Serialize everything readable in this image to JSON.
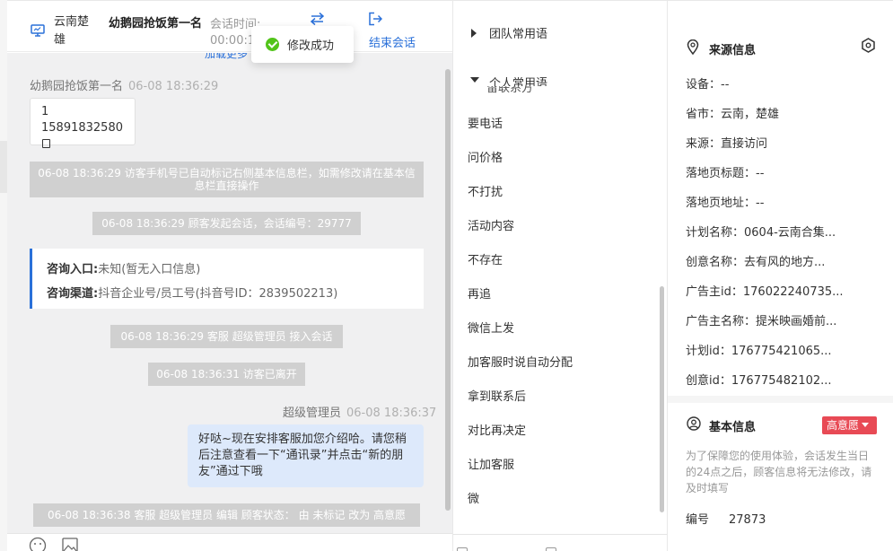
{
  "header": {
    "location": "云南楚雄",
    "visitor_name": "幼鹅园抢饭第一名",
    "session_time_label": "会话时间:",
    "session_time_value": "00:00:1",
    "end_session_label": "结束会话"
  },
  "toast": {
    "text": "修改成功"
  },
  "chat": {
    "load_more": "加载更多",
    "visitor_meta": {
      "name": "幼鹅园抢饭第一名",
      "time": "06-08 18:36:29"
    },
    "card": {
      "line1": "1",
      "line2": "15891832580"
    },
    "system_messages": [
      "06-08 18:36:29 访客手机号已自动标记右侧基本信息栏，如需修改请在基本信息栏直接操作",
      "06-08 18:36:29 顾客发起会话，会话编号：29777",
      "06-08 18:36:29 客服 超级管理员 接入会话",
      "06-08 18:36:31 访客已离开",
      "06-08 18:36:38 客服 超级管理员 编辑 顾客状态： 由 未标记 改为 高意愿"
    ],
    "info": {
      "entry_label": "咨询入口:",
      "entry_value": "未知(暂无入口信息)",
      "channel_label": "咨询渠道:",
      "channel_value": "抖音企业号/员工号(抖音号ID：2839502213)"
    },
    "agent_meta": {
      "name": "超级管理员",
      "time": "06-08 18:36:37"
    },
    "agent_message": "好哒~现在安排客服加您介绍哈。请您稍后注意查看一下“通讯录”并点击“新的朋友”通过下哦"
  },
  "phrases": {
    "team_group": "团队常用语",
    "personal_group": "个人常用语",
    "hidden_item": "留联系方",
    "items": [
      "要电话",
      "问价格",
      "不打扰",
      "活动内容",
      "不存在",
      "再追",
      "微信上发",
      "加客服时说自动分配",
      "拿到联系后",
      "对比再决定",
      "让加客服",
      "微"
    ]
  },
  "source_info": {
    "title": "来源信息",
    "rows": [
      {
        "label": "设备：",
        "value": "--"
      },
      {
        "label": "省市：",
        "value": "云南，楚雄"
      },
      {
        "label": "来源：",
        "value": "直接访问"
      },
      {
        "label": "落地页标题：",
        "value": "--"
      },
      {
        "label": "落地页地址：",
        "value": "--"
      },
      {
        "label": "计划名称：",
        "value": "0604-云南合集..."
      },
      {
        "label": "创意名称：",
        "value": "去有风的地方..."
      },
      {
        "label": "广告主id：",
        "value": "176022240735..."
      },
      {
        "label": "广告主名称：",
        "value": "提米映画婚前..."
      },
      {
        "label": "计划id：",
        "value": "176775421065..."
      },
      {
        "label": "创意id：",
        "value": "176775482102..."
      }
    ]
  },
  "basic_info": {
    "title": "基本信息",
    "status_tag": "高意愿",
    "notice": "为了保障您的使用体验，会话发生当日的24点之后，顾客信息将无法修改，请及时填写",
    "number_label": "编号",
    "number_value": "27873"
  },
  "colors": {
    "accent": "#2a70d9",
    "success": "#52c41a",
    "tag_red": "#e84a55",
    "bubble": "#dde9fb"
  }
}
